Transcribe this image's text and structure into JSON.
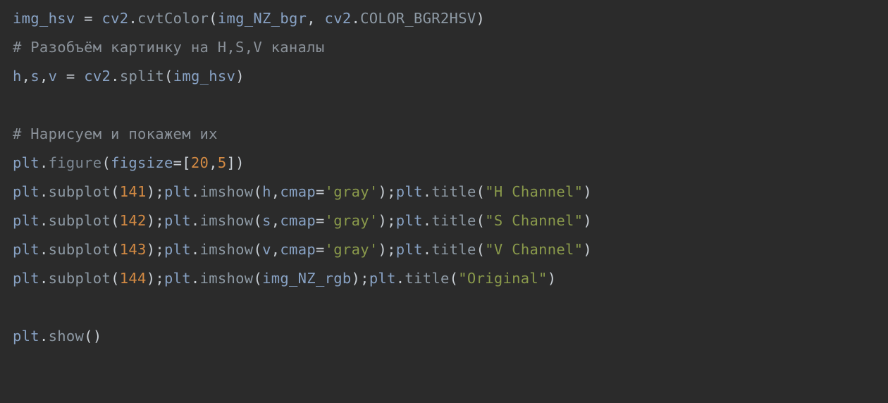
{
  "code": {
    "lines": [
      [
        {
          "cls": "tk-ident",
          "t": "img_hsv"
        },
        {
          "cls": "tk-op",
          "t": " = "
        },
        {
          "cls": "tk-module",
          "t": "cv2"
        },
        {
          "cls": "tk-op",
          "t": "."
        },
        {
          "cls": "tk-func",
          "t": "cvtColor"
        },
        {
          "cls": "tk-op",
          "t": "("
        },
        {
          "cls": "tk-ident",
          "t": "img_NZ_bgr"
        },
        {
          "cls": "tk-op",
          "t": ", "
        },
        {
          "cls": "tk-module",
          "t": "cv2"
        },
        {
          "cls": "tk-op",
          "t": "."
        },
        {
          "cls": "tk-func",
          "t": "COLOR_BGR2HSV"
        },
        {
          "cls": "tk-op",
          "t": ")"
        }
      ],
      [
        {
          "cls": "tk-comment",
          "t": "# Разобъём картинку на H,S,V каналы"
        }
      ],
      [
        {
          "cls": "tk-ident",
          "t": "h"
        },
        {
          "cls": "tk-op",
          "t": ","
        },
        {
          "cls": "tk-ident",
          "t": "s"
        },
        {
          "cls": "tk-op",
          "t": ","
        },
        {
          "cls": "tk-ident",
          "t": "v"
        },
        {
          "cls": "tk-op",
          "t": " = "
        },
        {
          "cls": "tk-module",
          "t": "cv2"
        },
        {
          "cls": "tk-op",
          "t": "."
        },
        {
          "cls": "tk-func",
          "t": "split"
        },
        {
          "cls": "tk-op",
          "t": "("
        },
        {
          "cls": "tk-ident",
          "t": "img_hsv"
        },
        {
          "cls": "tk-op",
          "t": ")"
        }
      ],
      [],
      [
        {
          "cls": "tk-comment",
          "t": "# Нарисуем и покажем их"
        }
      ],
      [
        {
          "cls": "tk-module",
          "t": "plt"
        },
        {
          "cls": "tk-op",
          "t": "."
        },
        {
          "cls": "tk-funcdim",
          "t": "figure"
        },
        {
          "cls": "tk-op",
          "t": "("
        },
        {
          "cls": "tk-kwarg",
          "t": "figsize"
        },
        {
          "cls": "tk-op",
          "t": "=["
        },
        {
          "cls": "tk-num",
          "t": "20"
        },
        {
          "cls": "tk-op",
          "t": ","
        },
        {
          "cls": "tk-num",
          "t": "5"
        },
        {
          "cls": "tk-op",
          "t": "])"
        }
      ],
      [
        {
          "cls": "tk-module",
          "t": "plt"
        },
        {
          "cls": "tk-op",
          "t": "."
        },
        {
          "cls": "tk-func",
          "t": "subplot"
        },
        {
          "cls": "tk-op",
          "t": "("
        },
        {
          "cls": "tk-num",
          "t": "141"
        },
        {
          "cls": "tk-op",
          "t": ");"
        },
        {
          "cls": "tk-module",
          "t": "plt"
        },
        {
          "cls": "tk-op",
          "t": "."
        },
        {
          "cls": "tk-func",
          "t": "imshow"
        },
        {
          "cls": "tk-op",
          "t": "("
        },
        {
          "cls": "tk-ident",
          "t": "h"
        },
        {
          "cls": "tk-op",
          "t": ","
        },
        {
          "cls": "tk-kwarg",
          "t": "cmap"
        },
        {
          "cls": "tk-op",
          "t": "="
        },
        {
          "cls": "tk-str",
          "t": "'gray'"
        },
        {
          "cls": "tk-op",
          "t": ");"
        },
        {
          "cls": "tk-module",
          "t": "plt"
        },
        {
          "cls": "tk-op",
          "t": "."
        },
        {
          "cls": "tk-func",
          "t": "title"
        },
        {
          "cls": "tk-op",
          "t": "("
        },
        {
          "cls": "tk-str",
          "t": "\"H Channel\""
        },
        {
          "cls": "tk-op",
          "t": ")"
        }
      ],
      [
        {
          "cls": "tk-module",
          "t": "plt"
        },
        {
          "cls": "tk-op",
          "t": "."
        },
        {
          "cls": "tk-func",
          "t": "subplot"
        },
        {
          "cls": "tk-op",
          "t": "("
        },
        {
          "cls": "tk-num",
          "t": "142"
        },
        {
          "cls": "tk-op",
          "t": ");"
        },
        {
          "cls": "tk-module",
          "t": "plt"
        },
        {
          "cls": "tk-op",
          "t": "."
        },
        {
          "cls": "tk-func",
          "t": "imshow"
        },
        {
          "cls": "tk-op",
          "t": "("
        },
        {
          "cls": "tk-ident",
          "t": "s"
        },
        {
          "cls": "tk-op",
          "t": ","
        },
        {
          "cls": "tk-kwarg",
          "t": "cmap"
        },
        {
          "cls": "tk-op",
          "t": "="
        },
        {
          "cls": "tk-str",
          "t": "'gray'"
        },
        {
          "cls": "tk-op",
          "t": ");"
        },
        {
          "cls": "tk-module",
          "t": "plt"
        },
        {
          "cls": "tk-op",
          "t": "."
        },
        {
          "cls": "tk-func",
          "t": "title"
        },
        {
          "cls": "tk-op",
          "t": "("
        },
        {
          "cls": "tk-str",
          "t": "\"S Channel\""
        },
        {
          "cls": "tk-op",
          "t": ")"
        }
      ],
      [
        {
          "cls": "tk-module",
          "t": "plt"
        },
        {
          "cls": "tk-op",
          "t": "."
        },
        {
          "cls": "tk-func",
          "t": "subplot"
        },
        {
          "cls": "tk-op",
          "t": "("
        },
        {
          "cls": "tk-num",
          "t": "143"
        },
        {
          "cls": "tk-op",
          "t": ");"
        },
        {
          "cls": "tk-module",
          "t": "plt"
        },
        {
          "cls": "tk-op",
          "t": "."
        },
        {
          "cls": "tk-func",
          "t": "imshow"
        },
        {
          "cls": "tk-op",
          "t": "("
        },
        {
          "cls": "tk-ident",
          "t": "v"
        },
        {
          "cls": "tk-op",
          "t": ","
        },
        {
          "cls": "tk-kwarg",
          "t": "cmap"
        },
        {
          "cls": "tk-op",
          "t": "="
        },
        {
          "cls": "tk-str",
          "t": "'gray'"
        },
        {
          "cls": "tk-op",
          "t": ");"
        },
        {
          "cls": "tk-module",
          "t": "plt"
        },
        {
          "cls": "tk-op",
          "t": "."
        },
        {
          "cls": "tk-func",
          "t": "title"
        },
        {
          "cls": "tk-op",
          "t": "("
        },
        {
          "cls": "tk-str",
          "t": "\"V Channel\""
        },
        {
          "cls": "tk-op",
          "t": ")"
        }
      ],
      [
        {
          "cls": "tk-module",
          "t": "plt"
        },
        {
          "cls": "tk-op",
          "t": "."
        },
        {
          "cls": "tk-func",
          "t": "subplot"
        },
        {
          "cls": "tk-op",
          "t": "("
        },
        {
          "cls": "tk-num",
          "t": "144"
        },
        {
          "cls": "tk-op",
          "t": ");"
        },
        {
          "cls": "tk-module",
          "t": "plt"
        },
        {
          "cls": "tk-op",
          "t": "."
        },
        {
          "cls": "tk-func",
          "t": "imshow"
        },
        {
          "cls": "tk-op",
          "t": "("
        },
        {
          "cls": "tk-ident",
          "t": "img_NZ_rgb"
        },
        {
          "cls": "tk-op",
          "t": ");"
        },
        {
          "cls": "tk-module",
          "t": "plt"
        },
        {
          "cls": "tk-op",
          "t": "."
        },
        {
          "cls": "tk-func",
          "t": "title"
        },
        {
          "cls": "tk-op",
          "t": "("
        },
        {
          "cls": "tk-str",
          "t": "\"Original\""
        },
        {
          "cls": "tk-op",
          "t": ")"
        }
      ],
      [],
      [
        {
          "cls": "tk-module",
          "t": "plt"
        },
        {
          "cls": "tk-op",
          "t": "."
        },
        {
          "cls": "tk-func",
          "t": "show"
        },
        {
          "cls": "tk-op",
          "t": "()"
        }
      ]
    ]
  }
}
